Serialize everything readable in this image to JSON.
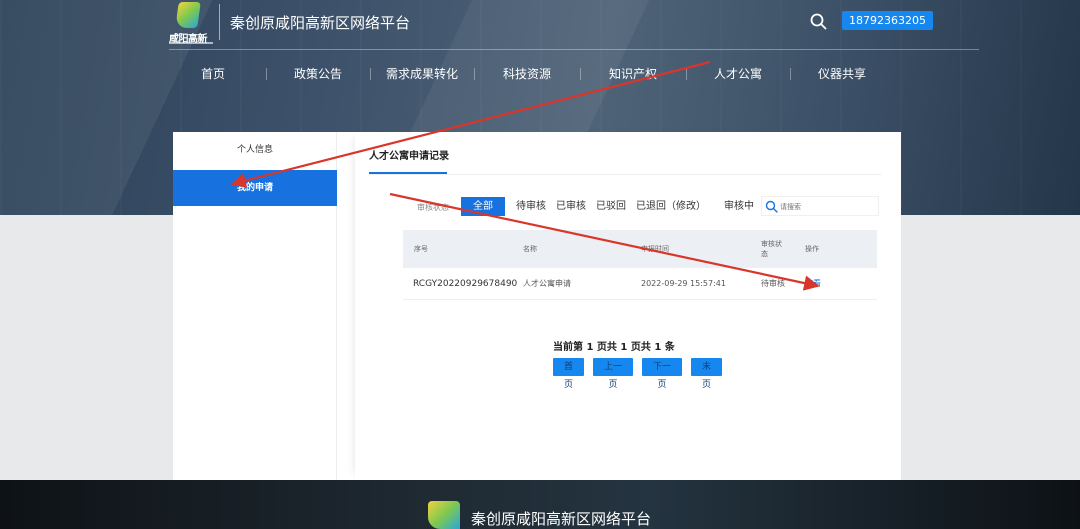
{
  "header": {
    "logo_text": "咸阳高新",
    "site_title": "秦创原咸阳高新区网络平台",
    "phone": "18792363205"
  },
  "nav": [
    "首页",
    "政策公告",
    "需求成果转化",
    "科技资源",
    "知识产权",
    "人才公寓",
    "仪器共享"
  ],
  "sidebar": {
    "items": [
      "个人信息",
      "我的申请"
    ],
    "active": "我的申请"
  },
  "content": {
    "title": "人才公寓申请记录",
    "filter_label": "审核状态",
    "filters": [
      "全部",
      "待审核",
      "已审核",
      "已驳回",
      "已退回（修改）",
      "审核中"
    ],
    "search_placeholder": "请搜索",
    "table": {
      "headers": [
        "序号",
        "名称",
        "申报时间",
        "审核状态",
        "操作"
      ],
      "rows": [
        [
          "RCGY20220929678490",
          "人才公寓申请",
          "2022-09-29 15:57:41",
          "待审核",
          "查看"
        ]
      ]
    },
    "pagination": {
      "summary": "当前第 1 页共 1 页共 1 条",
      "buttons": [
        "首页",
        "上一页",
        "下一页",
        "末页"
      ]
    }
  },
  "footer": {
    "title": "秦创原咸阳高新区网络平台"
  },
  "colors": {
    "accent": "#1772e0",
    "button": "#1787f0",
    "annotation": "#d9362b"
  }
}
